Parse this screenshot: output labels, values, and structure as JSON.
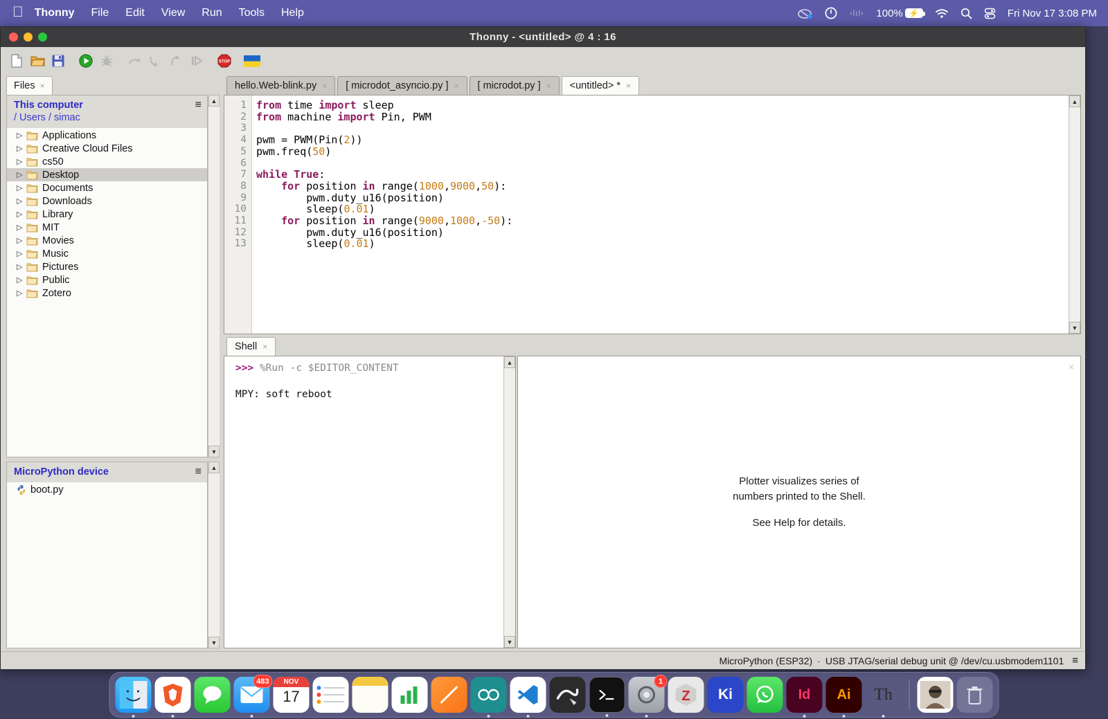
{
  "menubar": {
    "apple": "apple-logo",
    "items": [
      "Thonny",
      "File",
      "Edit",
      "View",
      "Run",
      "Tools",
      "Help"
    ],
    "status": {
      "battery_percent": "100%",
      "clock": "Fri Nov 17  3:08 PM"
    }
  },
  "window": {
    "title": "Thonny  -  <untitled> @ 4 : 16"
  },
  "toolbar": {
    "buttons": [
      {
        "name": "new-file",
        "label": "New"
      },
      {
        "name": "open-file",
        "label": "Open"
      },
      {
        "name": "save-file",
        "label": "Save"
      },
      {
        "name": "run-script",
        "label": "Run"
      },
      {
        "name": "debug-script",
        "label": "Debug"
      },
      {
        "name": "step-over",
        "label": "Step over"
      },
      {
        "name": "step-into",
        "label": "Step into"
      },
      {
        "name": "step-out",
        "label": "Step out"
      },
      {
        "name": "resume",
        "label": "Resume"
      },
      {
        "name": "stop-script",
        "label": "Stop"
      },
      {
        "name": "ukraine-flag",
        "label": "Support Ukraine"
      }
    ]
  },
  "files_panel": {
    "tab_label": "Files",
    "this_computer": "This computer",
    "path_parts": [
      "Users",
      "simac"
    ],
    "path_display": "/ Users / simac",
    "menu_icon": "≡",
    "items": [
      {
        "label": "Applications",
        "selected": false
      },
      {
        "label": "Creative Cloud Files",
        "selected": false
      },
      {
        "label": "cs50",
        "selected": false
      },
      {
        "label": "Desktop",
        "selected": true
      },
      {
        "label": "Documents",
        "selected": false
      },
      {
        "label": "Downloads",
        "selected": false
      },
      {
        "label": "Library",
        "selected": false
      },
      {
        "label": "MIT",
        "selected": false
      },
      {
        "label": "Movies",
        "selected": false
      },
      {
        "label": "Music",
        "selected": false
      },
      {
        "label": "Pictures",
        "selected": false
      },
      {
        "label": "Public",
        "selected": false
      },
      {
        "label": "Zotero",
        "selected": false
      }
    ]
  },
  "device_panel": {
    "title": "MicroPython device",
    "menu_icon": "≡",
    "files": [
      {
        "label": "boot.py"
      }
    ]
  },
  "editor": {
    "tabs": [
      {
        "label": "hello.Web-blink.py",
        "active": false,
        "modified": false
      },
      {
        "label": "[ microdot_asyncio.py ]",
        "active": false,
        "modified": false
      },
      {
        "label": "[ microdot.py ]",
        "active": false,
        "modified": false
      },
      {
        "label": "<untitled> *",
        "active": true,
        "modified": true
      }
    ],
    "line_numbers": [
      "1",
      "2",
      "3",
      "4",
      "5",
      "6",
      "7",
      "8",
      "9",
      "10",
      "11",
      "12",
      "13"
    ],
    "lines": [
      "from time import sleep",
      "from machine import Pin, PWM",
      "",
      "pwm = PWM(Pin(2))",
      "pwm.freq(50)",
      "",
      "while True:",
      "    for position in range(1000,9000,50):",
      "        pwm.duty_u16(position)",
      "        sleep(0.01)",
      "    for position in range(9000,1000,-50):",
      "        pwm.duty_u16(position)",
      "        sleep(0.01)"
    ]
  },
  "shell": {
    "tab_label": "Shell",
    "prompt": ">>>",
    "command": "%Run -c $EDITOR_CONTENT",
    "output": "MPY: soft reboot"
  },
  "plotter": {
    "line1": "Plotter visualizes series of",
    "line2": "numbers printed to the Shell.",
    "line3": "See Help for details.",
    "close_icon": "×"
  },
  "statusbar": {
    "interpreter": "MicroPython (ESP32)",
    "separator": "·",
    "connection": "USB JTAG/serial debug unit @ /dev/cu.usbmodem1101",
    "menu_icon": "≡"
  },
  "dock": {
    "items": [
      {
        "name": "finder",
        "label": "Finder",
        "running": true,
        "badge": ""
      },
      {
        "name": "brave-browser",
        "label": "Brave",
        "running": true,
        "badge": ""
      },
      {
        "name": "messages",
        "label": "Messages",
        "running": false,
        "badge": ""
      },
      {
        "name": "mail",
        "label": "Mail",
        "running": true,
        "badge": "483"
      },
      {
        "name": "calendar",
        "label": "Calendar",
        "running": false,
        "badge": "",
        "month": "NOV",
        "day": "17"
      },
      {
        "name": "reminders",
        "label": "Reminders",
        "running": false,
        "badge": ""
      },
      {
        "name": "notes",
        "label": "Notes",
        "running": false,
        "badge": ""
      },
      {
        "name": "numbers",
        "label": "Numbers",
        "running": false,
        "badge": ""
      },
      {
        "name": "freeform",
        "label": "Freeform",
        "running": false,
        "badge": ""
      },
      {
        "name": "arduino-ide",
        "label": "Arduino IDE",
        "running": true,
        "badge": ""
      },
      {
        "name": "vs-code",
        "label": "Visual Studio Code",
        "running": true,
        "badge": ""
      },
      {
        "name": "fritzing",
        "label": "Fritzing",
        "running": false,
        "badge": ""
      },
      {
        "name": "terminal",
        "label": "Terminal",
        "running": true,
        "badge": ""
      },
      {
        "name": "system-settings",
        "label": "System Settings",
        "running": true,
        "badge": "1"
      },
      {
        "name": "zotero",
        "label": "Zotero",
        "running": false,
        "badge": ""
      },
      {
        "name": "kicad",
        "label": "KiCad",
        "running": false,
        "badge": ""
      },
      {
        "name": "whatsapp",
        "label": "WhatsApp",
        "running": false,
        "badge": ""
      },
      {
        "name": "indesign",
        "label": "InDesign",
        "running": true,
        "badge": ""
      },
      {
        "name": "illustrator",
        "label": "Illustrator",
        "running": true,
        "badge": ""
      },
      {
        "name": "thonny",
        "label": "Thonny",
        "running": true,
        "badge": ""
      },
      {
        "name": "photo-booth",
        "label": "Photos",
        "running": false,
        "badge": ""
      },
      {
        "name": "trash",
        "label": "Trash",
        "running": false,
        "badge": ""
      }
    ]
  }
}
